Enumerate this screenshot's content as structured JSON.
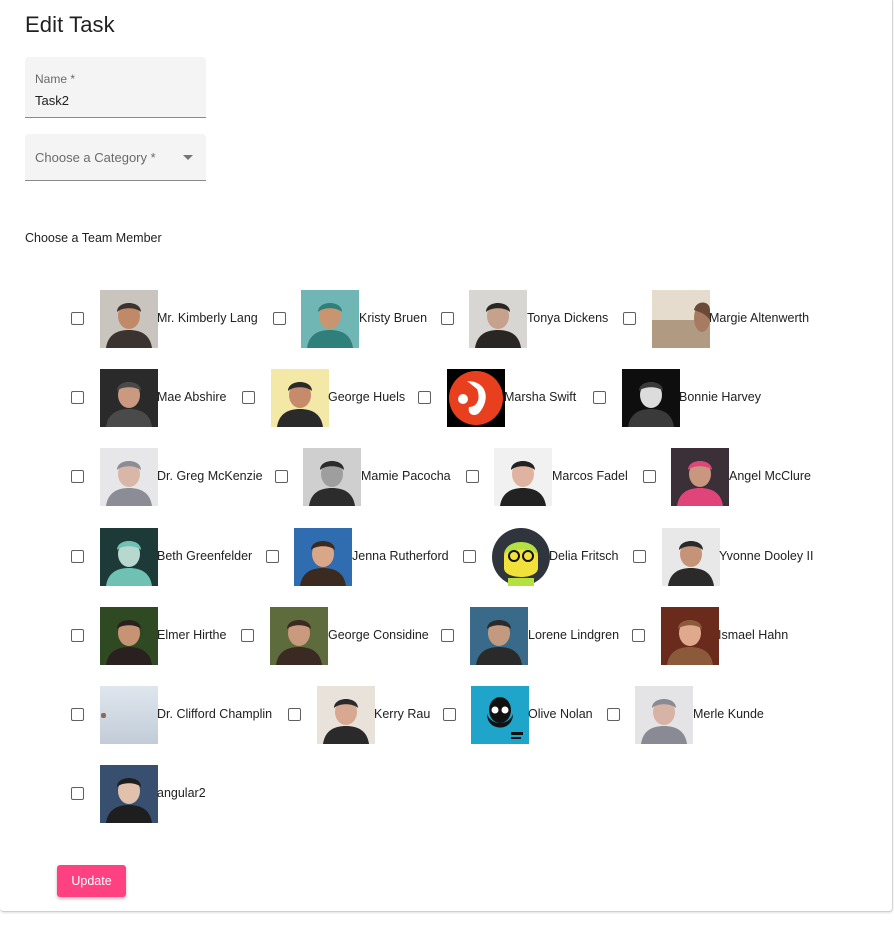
{
  "form": {
    "title": "Edit Task",
    "name_label": "Name *",
    "name_value": "Task2",
    "category_label": "Choose a Category *",
    "team_label": "Choose a Team Member",
    "update_label": "Update",
    "accent_color": "#ff4081"
  },
  "members": [
    {
      "name": "Mr. Kimberly Lang",
      "checked": false,
      "icon": "portrait-man-suit",
      "colors": [
        "#c9c4bd",
        "#3a3330",
        "#c08a68"
      ]
    },
    {
      "name": "Kristy Bruen",
      "checked": false,
      "icon": "portrait-balloons",
      "colors": [
        "#6fb6b4",
        "#2f7f7a",
        "#c99470"
      ]
    },
    {
      "name": "Tonya Dickens",
      "checked": false,
      "icon": "portrait-man-dark",
      "colors": [
        "#d8d6d2",
        "#2a2624",
        "#c6a18c"
      ]
    },
    {
      "name": "Margie Altenwerth",
      "checked": false,
      "icon": "portrait-beach",
      "colors": [
        "#e6dcce",
        "#b09a82",
        "#a67b62"
      ]
    },
    {
      "name": "Mae Abshire",
      "checked": false,
      "icon": "portrait-man-smile",
      "colors": [
        "#2a2a2a",
        "#4a4a4a",
        "#c99a80"
      ]
    },
    {
      "name": "George Huels",
      "checked": false,
      "icon": "portrait-sunglasses",
      "colors": [
        "#f3e8a6",
        "#2a2a2a",
        "#c68b6a"
      ]
    },
    {
      "name": "Marsha Swift",
      "checked": false,
      "icon": "logo-red-circle",
      "colors": [
        "#000000",
        "#e8401f",
        "#ffffff"
      ]
    },
    {
      "name": "Bonnie Harvey",
      "checked": false,
      "icon": "portrait-bw",
      "colors": [
        "#0e0e0e",
        "#3a3a3a",
        "#dcdcdc"
      ]
    },
    {
      "name": "Dr. Greg McKenzie",
      "checked": false,
      "icon": "portrait-surprised",
      "colors": [
        "#e7e7ea",
        "#8c8c96",
        "#d8b6a8"
      ]
    },
    {
      "name": "Mamie Pacocha",
      "checked": false,
      "icon": "portrait-bw-man",
      "colors": [
        "#cfcfcf",
        "#2c2c2c",
        "#9e9e9e"
      ]
    },
    {
      "name": "Marcos Fadel",
      "checked": false,
      "icon": "portrait-red-shirt",
      "colors": [
        "#f1f1f1",
        "#222222",
        "#e0b3a0"
      ]
    },
    {
      "name": "Angel McClure",
      "checked": false,
      "icon": "portrait-pink-glasses",
      "colors": [
        "#3b2f38",
        "#e0457a",
        "#c99680"
      ]
    },
    {
      "name": "Beth Greenfelder",
      "checked": false,
      "icon": "portrait-cap-teal",
      "colors": [
        "#1e3a38",
        "#6fc2b3",
        "#b6d8cf"
      ]
    },
    {
      "name": "Jenna Rutherford",
      "checked": false,
      "icon": "portrait-glasses-smile",
      "colors": [
        "#2f6cb0",
        "#3a2a20",
        "#d9a787"
      ]
    },
    {
      "name": "Delia Fritsch",
      "checked": false,
      "icon": "illustration-green-face",
      "colors": [
        "#30353d",
        "#b4e041",
        "#f2e13a"
      ]
    },
    {
      "name": "Yvonne Dooley II",
      "checked": false,
      "icon": "portrait-man-smile",
      "colors": [
        "#e8e8e8",
        "#2a2a2a",
        "#c59478"
      ]
    },
    {
      "name": "Elmer Hirthe",
      "checked": false,
      "icon": "portrait-woman-glasses",
      "colors": [
        "#2f4a22",
        "#2a2020",
        "#c79375"
      ]
    },
    {
      "name": "George Considine",
      "checked": false,
      "icon": "portrait-outdoors",
      "colors": [
        "#5e6b3c",
        "#3a2a22",
        "#c99a7e"
      ]
    },
    {
      "name": "Lorene Lindgren",
      "checked": false,
      "icon": "portrait-blue-art",
      "colors": [
        "#3a6a8a",
        "#2a2a2a",
        "#c39a80"
      ]
    },
    {
      "name": "Ismael Hahn",
      "checked": false,
      "icon": "portrait-woman-warm",
      "colors": [
        "#6a2a1c",
        "#8a5a3a",
        "#e0a88c"
      ]
    },
    {
      "name": "Dr. Clifford Champlin",
      "checked": false,
      "icon": "portrait-sky",
      "colors": [
        "#dfe6ee",
        "#c2ccd8",
        "#8a6a5a"
      ]
    },
    {
      "name": "Kerry Rau",
      "checked": false,
      "icon": "portrait-selfie",
      "colors": [
        "#e9e2da",
        "#2a2a2a",
        "#d8a890"
      ]
    },
    {
      "name": "Olive Nolan",
      "checked": false,
      "icon": "illustration-bearded-man",
      "colors": [
        "#1fa5c9",
        "#111111",
        "#ffffff"
      ]
    },
    {
      "name": "Merle Kunde",
      "checked": false,
      "icon": "portrait-surprised",
      "colors": [
        "#e4e4e6",
        "#8a8a94",
        "#d6b3a5"
      ]
    },
    {
      "name": "angular2",
      "checked": false,
      "icon": "portrait-young-man",
      "colors": [
        "#384f70",
        "#1e1e1e",
        "#e2c1ac"
      ]
    }
  ]
}
